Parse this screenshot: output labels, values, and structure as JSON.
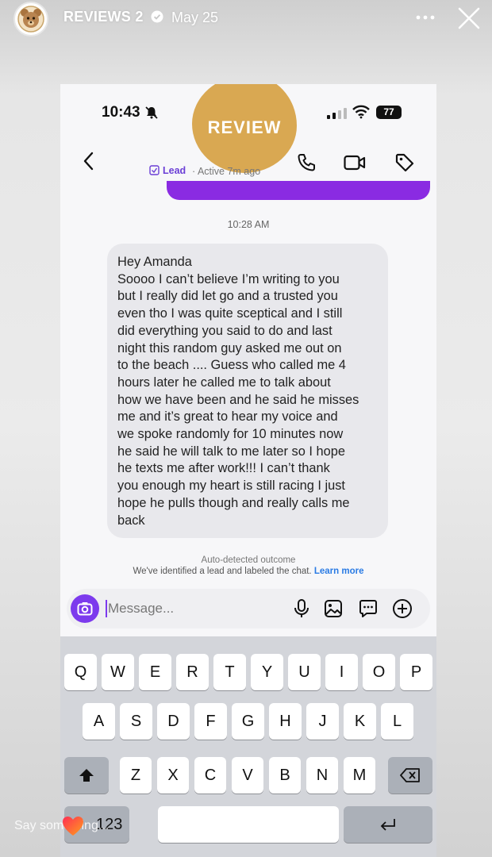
{
  "story": {
    "account_name": "REVIEWS 2",
    "date": "May 25",
    "reply_placeholder": "Say something..."
  },
  "phone": {
    "status_time": "10:43",
    "battery": "77",
    "review_badge": "REVIEW",
    "lead_label": "Lead",
    "active_status": "· Active 7m ago",
    "timestamp": "10:28 AM",
    "message": {
      "greeting": "Hey Amanda",
      "lines": [
        "Soooo I can’t believe I’m writing to you",
        "but I really did let go and a trusted you",
        "even tho I was quite sceptical and I still",
        "did everything you said to do and last",
        "night this random guy asked me out on",
        "to the beach .... Guess who called me 4",
        "hours later he called me to talk about",
        "how we have been and he said he misses",
        "me and it’s great to hear my voice and",
        "we spoke randomly for 10 minutes now",
        "he said he will talk to me later so I hope",
        "he texts me after work!!! I can’t thank",
        "you enough my heart is still racing I just",
        "hope he pulls though and really calls me",
        "back"
      ]
    },
    "auto_detected_title": "Auto-detected outcome",
    "auto_detected_desc": "We've identified a lead and labeled the chat.",
    "learn_more": "Learn more",
    "composer_placeholder": "Message...",
    "keyboard": {
      "row1": [
        "Q",
        "W",
        "E",
        "R",
        "T",
        "Y",
        "U",
        "I",
        "O",
        "P"
      ],
      "row2": [
        "A",
        "S",
        "D",
        "F",
        "G",
        "H",
        "J",
        "K",
        "L"
      ],
      "row3": [
        "Z",
        "X",
        "C",
        "V",
        "B",
        "N",
        "M"
      ],
      "numbers_key": "123"
    }
  },
  "colors": {
    "accent_purple": "#7c3aed",
    "review_badge": "#d9a852",
    "link_blue": "#2a7be4"
  }
}
